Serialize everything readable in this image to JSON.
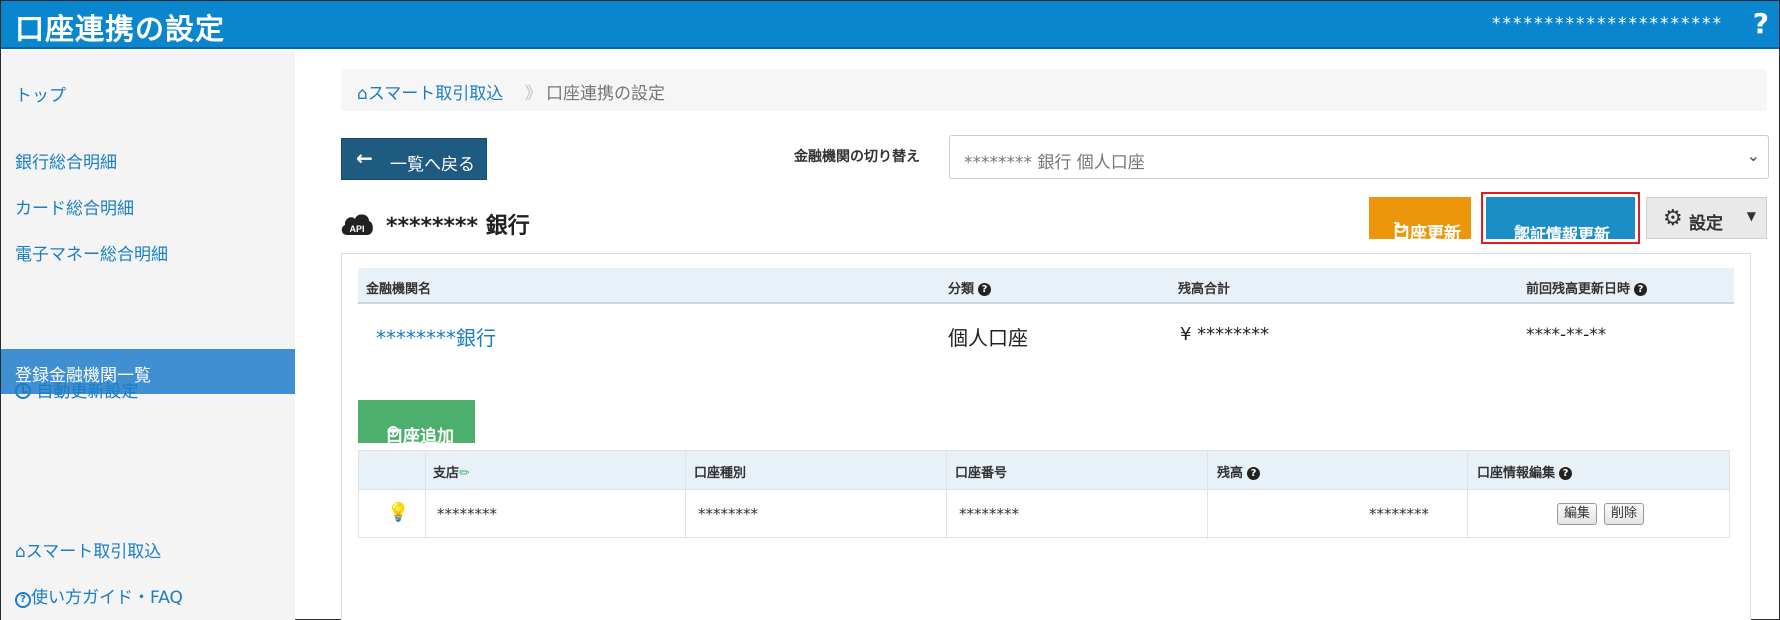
{
  "header": {
    "title": "口座連携の設定",
    "user_mask": "**********************",
    "help_label": "?"
  },
  "sidebar": {
    "items": [
      {
        "label": "トップ"
      },
      {
        "label": "銀行総合明細"
      },
      {
        "label": "カード総合明細"
      },
      {
        "label": "電子マネー総合明細"
      },
      {
        "label": "登録金融機関一覧"
      },
      {
        "label": "自動更新設定"
      },
      {
        "label": "スマート取引取込"
      },
      {
        "label": "使い方ガイド・FAQ"
      }
    ]
  },
  "breadcrumb": {
    "home": "スマート取引取込",
    "separator": "》",
    "current": "口座連携の設定"
  },
  "toolbar": {
    "back_label": "一覧へ戻る",
    "switch_label": "金融機関の切り替え",
    "switch_value": "******** 銀行  個人口座"
  },
  "bank": {
    "title": "******** 銀行",
    "api_badge": "API",
    "update_label": "口座更新",
    "auth_label": "認証情報更新",
    "settings_label": "設定"
  },
  "summary": {
    "headers": [
      "金融機関名",
      "分類",
      "残高合計",
      "前回残高更新日時"
    ],
    "row": {
      "name": "********銀行",
      "category": "個人口座",
      "total": "¥ ********",
      "updated": "****-**-**"
    }
  },
  "accounts": {
    "add_label": "口座追加",
    "headers": [
      "支店",
      "口座種別",
      "口座番号",
      "残高",
      "口座情報編集"
    ],
    "rows": [
      {
        "branch": "********",
        "type": "********",
        "number": "********",
        "balance": "********",
        "edit_label": "編集",
        "delete_label": "削除"
      }
    ]
  },
  "colors": {
    "header_bg": "#0a86cf",
    "sidebar_active": "#3f8fd2",
    "update_btn": "#ec960b",
    "auth_btn": "#1d8dc5",
    "add_btn": "#4caf6e",
    "back_btn": "#1f5b80",
    "highlight_border": "#e11c1c"
  }
}
